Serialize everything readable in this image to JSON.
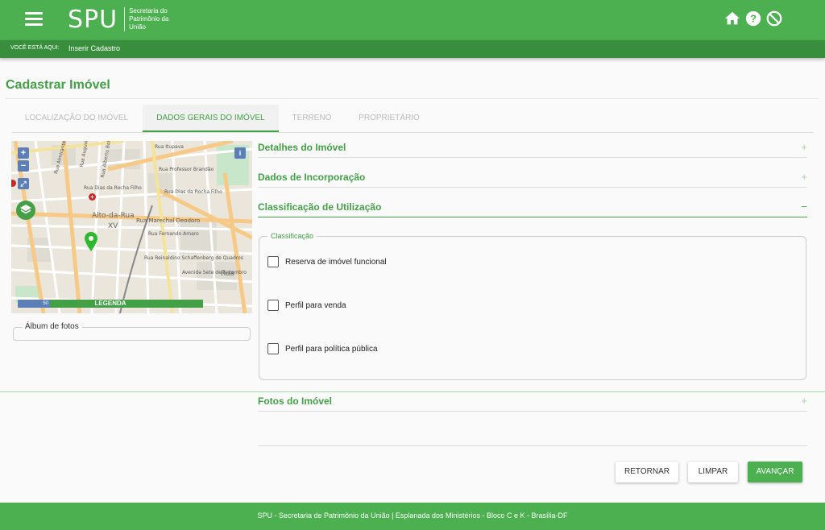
{
  "header": {
    "logo_mark": "SPU",
    "logo_text": "Secretaria do Patrimônio da União",
    "icons": [
      "home-icon",
      "help-icon",
      "block-icon"
    ]
  },
  "breadcrumb": {
    "label": "VOCÊ ESTÁ AQUI:",
    "current": "Inserir Cadastro"
  },
  "page": {
    "title": "Cadastrar Imóvel"
  },
  "tabs": [
    {
      "label": "LOCALIZAÇÃO DO IMÓVEL",
      "active": false
    },
    {
      "label": "DADOS GERAIS DO IMÓVEL",
      "active": true
    },
    {
      "label": "TERRENO",
      "active": false
    },
    {
      "label": "PROPRIETÁRIO",
      "active": false
    }
  ],
  "map": {
    "zoom_in": "+",
    "zoom_out": "−",
    "info": "i",
    "legend": "LEGENDA",
    "scale": "50",
    "street_labels": [
      "Rua Itupava",
      "Rua Professor Brandão",
      "Rua Dias da Rocha Filho",
      "Rua Dias da Rocha Filho",
      "Rua Marechal Deodoro",
      "Alto-da-Rua",
      "XV",
      "Rua Fernando Amaro",
      "Rua Reinaldino Schaffenberg de Quadros",
      "Avenida Sete de Setembro",
      "Rua",
      "Rua Almirante Tamandaré",
      "Rua Augusto Stresser",
      "Rua Alberto Bolliger"
    ]
  },
  "album": {
    "label": "Álbum de fotos"
  },
  "sections": [
    {
      "title": "Detalhes do Imóvel",
      "sign": "+"
    },
    {
      "title": "Dados de Incorporação",
      "sign": "+"
    },
    {
      "title": "Classificação de Utilização",
      "sign": "−"
    },
    {
      "title": "Fotos do Imóvel",
      "sign": "+"
    }
  ],
  "classificacao": {
    "legend": "Classificação",
    "options": [
      {
        "label": "Reserva de imóvel funcional",
        "checked": false
      },
      {
        "label": "Perfil para venda",
        "checked": false
      },
      {
        "label": "Perfil para política pública",
        "checked": false
      }
    ]
  },
  "buttons": {
    "back": "RETORNAR",
    "clear": "LIMPAR",
    "next": "AVANÇAR"
  },
  "footer": {
    "text": "SPU - Secretaria de Patrimônio da União | Esplanada dos Ministérios - Bloco C e K - Brasília-DF"
  },
  "colors": {
    "primary": "#4caf50",
    "primary_dark": "#388e3c",
    "accent_text": "#43a047"
  }
}
